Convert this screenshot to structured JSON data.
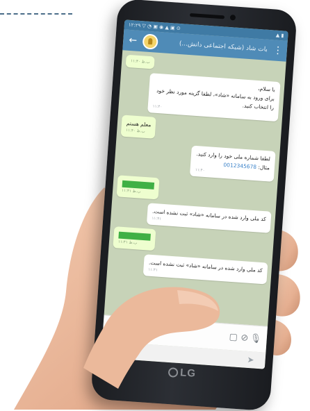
{
  "colors": {
    "header": "#4f8bb7",
    "chat_background": "#c7d3b8",
    "incoming_bubble": "#ffffff",
    "outgoing_bubble": "#eefecf",
    "redaction": "#40b045",
    "link": "#3a82c9"
  },
  "device": {
    "brand": "LG"
  },
  "status_bar": {
    "left": "۱۲:۲۹ ▽ ◔ ▣ ◉ ▲ ▣ ⊙",
    "right": "▲ ▮"
  },
  "header": {
    "back_icon": "arrow-left-icon",
    "title": "بات شاد (شبکه اجتماعی دانش...)",
    "menu_icon": "more-vert-icon"
  },
  "messages": [
    {
      "dir": "out",
      "text": "",
      "time": "۱۱:۴۰ ب.ظ"
    },
    {
      "dir": "in",
      "text": "با سلام، \nبرای ورود به سامانه «شاد»، لطفا گزینه مورد نظر خود را انتخاب کنید.",
      "time": "۱۱:۴۰"
    },
    {
      "dir": "out",
      "text": "معلم هستم",
      "time": "۱۱:۴۰ ب.ظ"
    },
    {
      "dir": "in",
      "text": "لطفا شماره ملی خود را وارد کنید.\nمثال:",
      "link": "0012345678",
      "time": "۱۱:۴۰"
    },
    {
      "dir": "out",
      "redacted": true,
      "time": "۱۱:۴۱ ب.ظ"
    },
    {
      "dir": "in",
      "text": "کد ملی وارد شده در سامانه «شاد» ثبت نشده است.",
      "time": "۱۱:۴۱"
    },
    {
      "dir": "out",
      "redacted": true,
      "time": "۱۱:۴۱ ب.ظ"
    },
    {
      "dir": "in",
      "text": "کد ملی وارد شده در سامانه «شاد» ثبت نشده است.",
      "time": "۱۱:۴۱"
    }
  ],
  "toolbar": {
    "emoji_icon": "☺",
    "camera_icon": "▢",
    "attach_icon": "⊘",
    "mic_icon": "🎙"
  },
  "input": {
    "send_icon": "➤"
  }
}
